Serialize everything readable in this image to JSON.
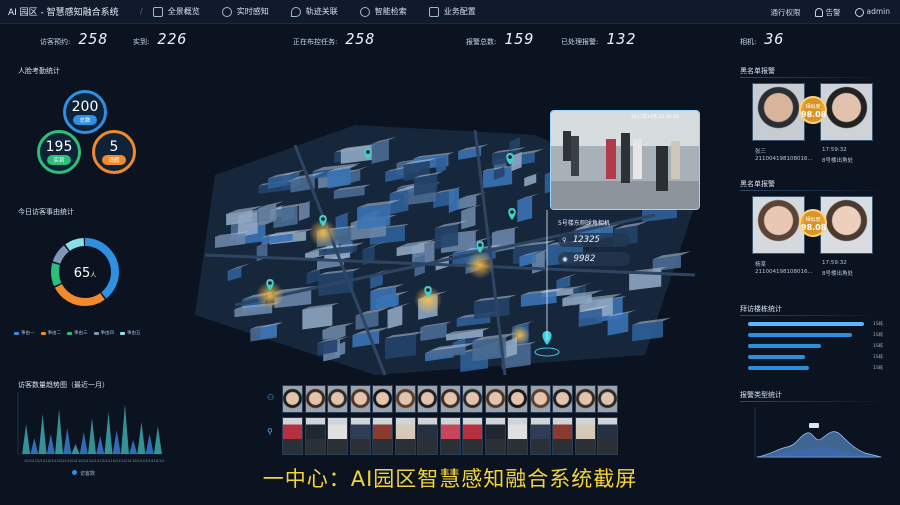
{
  "topbar": {
    "brand": "AI 园区 - 智慧感知融合系统",
    "nav": [
      {
        "label": "全景概览",
        "icon": "building-icon"
      },
      {
        "label": "实时感知",
        "icon": "radar-icon"
      },
      {
        "label": "轨迹关联",
        "icon": "location-icon"
      },
      {
        "label": "智能检索",
        "icon": "search-icon"
      },
      {
        "label": "业务配置",
        "icon": "sliders-icon"
      }
    ],
    "right": {
      "access": "通行权限",
      "alarm": "告警",
      "user": "admin"
    }
  },
  "stats": {
    "visit_label": "访客预约:",
    "visit_value": "258",
    "arrive_label": "实到:",
    "arrive_value": "226",
    "task_label": "正在布控任务:",
    "task_value": "258",
    "alarm_label": "报警总数:",
    "alarm_value": "159",
    "handled_label": "已处理报警:",
    "handled_value": "132",
    "camera_label": "相机:",
    "camera_value": "36"
  },
  "left": {
    "attendance_title": "人脸考勤统计",
    "total_value": "200",
    "total_label": "总数",
    "present_value": "195",
    "present_label": "实到",
    "leave_value": "5",
    "leave_label": "请假",
    "visitor_title": "今日访客事由统计",
    "donut_value": "65",
    "donut_unit": "人",
    "donut_segments": [
      {
        "label": "事由一",
        "value": 40,
        "color": "#2f8fe0"
      },
      {
        "label": "事由二",
        "value": 28,
        "color": "#f08a2c"
      },
      {
        "label": "事由三",
        "value": 12,
        "color": "#2bbf7a"
      },
      {
        "label": "事由四",
        "value": 10,
        "color": "#7f97b8"
      },
      {
        "label": "事由五",
        "value": 10,
        "color": "#8be0e8"
      }
    ],
    "trend_title": "访客数量趋势图（最近一月）",
    "trend_legend": "访客数",
    "trend_x": [
      "10/14",
      "10/14",
      "10/14",
      "10/14",
      "10/14",
      "10/14",
      "10/14",
      "10/14",
      "10/14",
      "10/14",
      "10/14",
      "10/14",
      "10/14"
    ]
  },
  "camera": {
    "name": "5号楼东侧球角相机",
    "count1": "12325",
    "count2": "9982",
    "overlay_time": "2017年11月 22:40:22"
  },
  "right": {
    "blacklist_title": "黑名单报警",
    "alarm1": {
      "name": "张三",
      "id": "211004198108016...",
      "time": "17:59:32",
      "place": "8号楼出角处",
      "sim_label": "相似度",
      "sim_value": "98.08"
    },
    "alarm2": {
      "name": "杨某",
      "id": "211004198108016...",
      "time": "17:59:32",
      "place": "8号楼出角处",
      "sim_label": "相似度",
      "sim_value": "98.08"
    },
    "flow_title": "拜访楼栋统计",
    "flow_bars": [
      {
        "label": "1S栋",
        "value": 95
      },
      {
        "label": "1S栋",
        "value": 85
      },
      {
        "label": "1S栋",
        "value": 60
      },
      {
        "label": "1S栋",
        "value": 47
      },
      {
        "label": "1S栋",
        "value": 50
      }
    ],
    "alarm_type_title": "报警类型统计"
  },
  "strip": {
    "face_icon": "person-icon",
    "body_icon": "walking-icon"
  },
  "caption": "一中心：AI园区智慧感知融合系统截屏",
  "colors": {
    "accent": "#2f8fe0",
    "orange": "#f08a2c",
    "green": "#2bbf7a",
    "alarm": "#f4d43a"
  }
}
